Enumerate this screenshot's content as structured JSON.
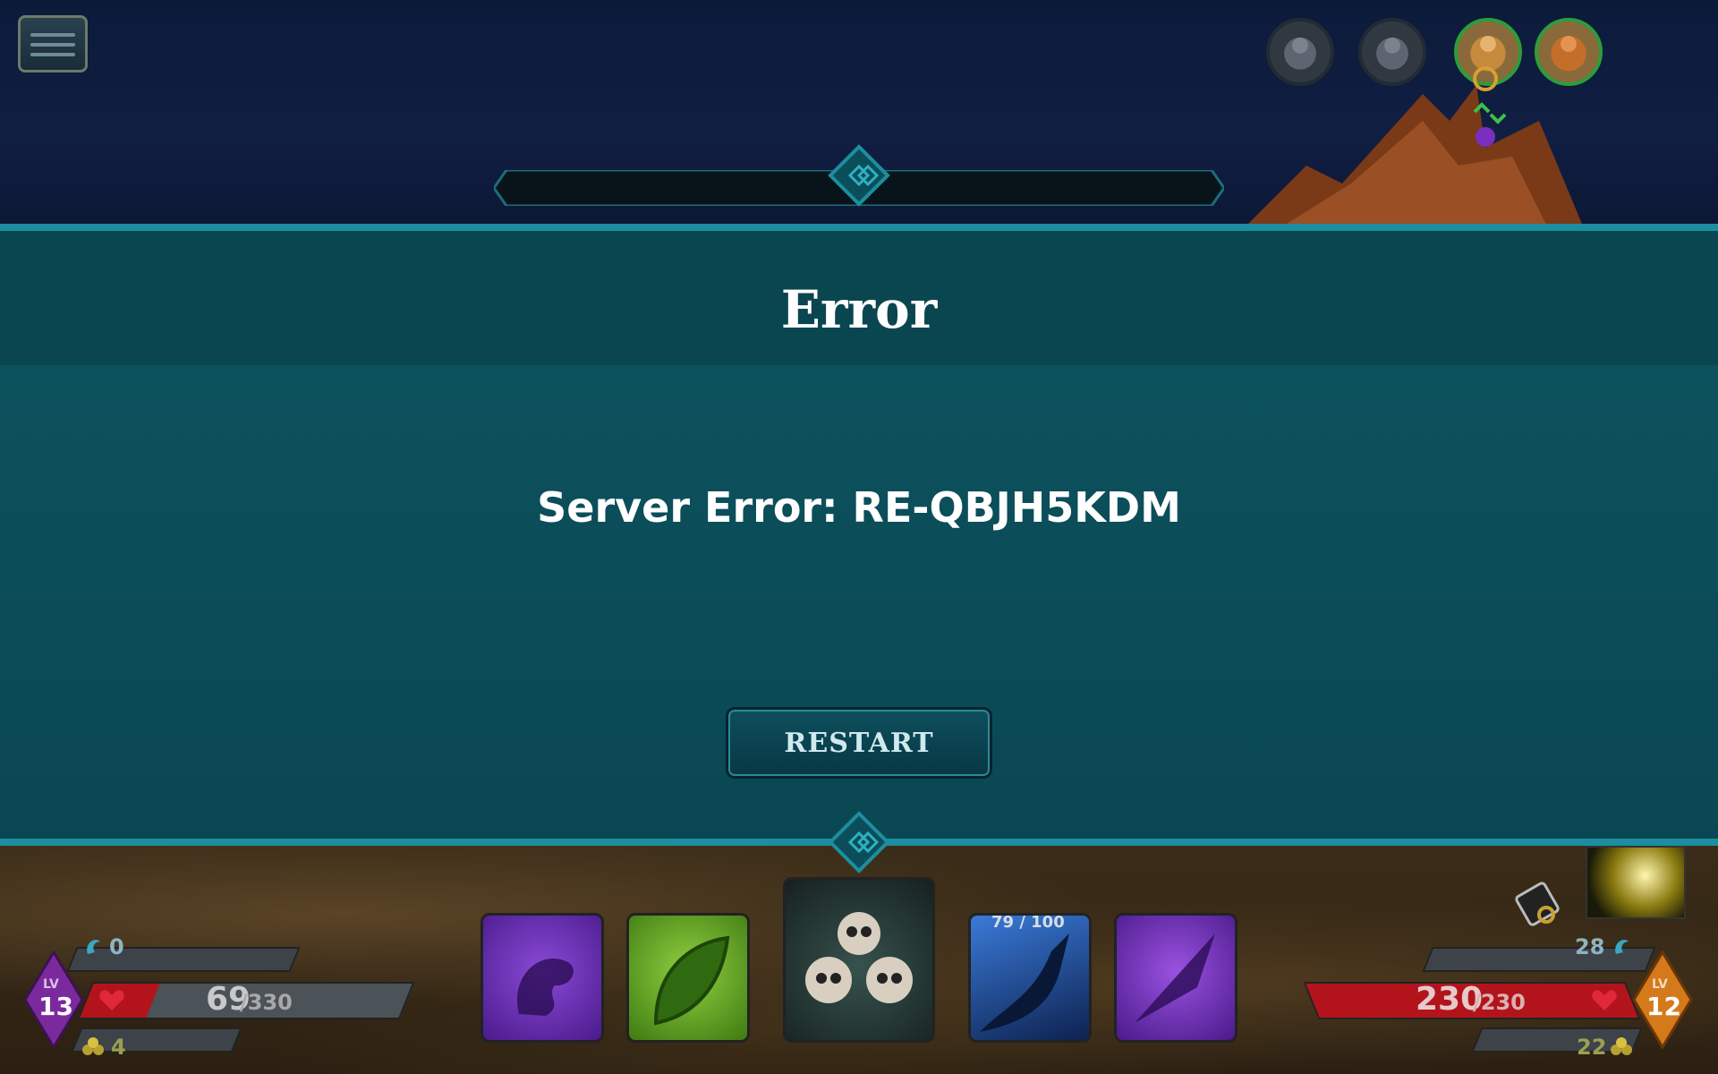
{
  "timer": {
    "value": "0.0"
  },
  "dialog": {
    "title": "Error",
    "message": "Server Error: RE-QBJH5KDM",
    "button_label": "RESTART"
  },
  "player": {
    "level_label": "LV",
    "level": "13",
    "mana": "0",
    "hp_current": "69",
    "hp_max": "/330",
    "hp_fraction": 0.21,
    "gold": "4"
  },
  "enemy": {
    "level_label": "LV",
    "level": "12",
    "mana": "28",
    "hp_current": "230",
    "hp_max": "/230",
    "hp_fraction": 1.0,
    "gold": "22"
  },
  "cards": [
    {
      "name": "dragon-card",
      "color": "#6a2bb5"
    },
    {
      "name": "acid-card",
      "color": "#4f9a1e"
    },
    {
      "name": "skull-card",
      "color": "#2b3a3a"
    },
    {
      "name": "shadow-claw-card",
      "color": "#1d3f8a",
      "counter": "79 / 100"
    },
    {
      "name": "blade-card",
      "color": "#6a2bb5"
    }
  ],
  "colors": {
    "panel": "#0b4e5a",
    "accent_line": "#1c8ea0",
    "hp_red": "#b3141c",
    "player_badge": "#7b2a9e",
    "enemy_badge": "#d47a1a"
  }
}
